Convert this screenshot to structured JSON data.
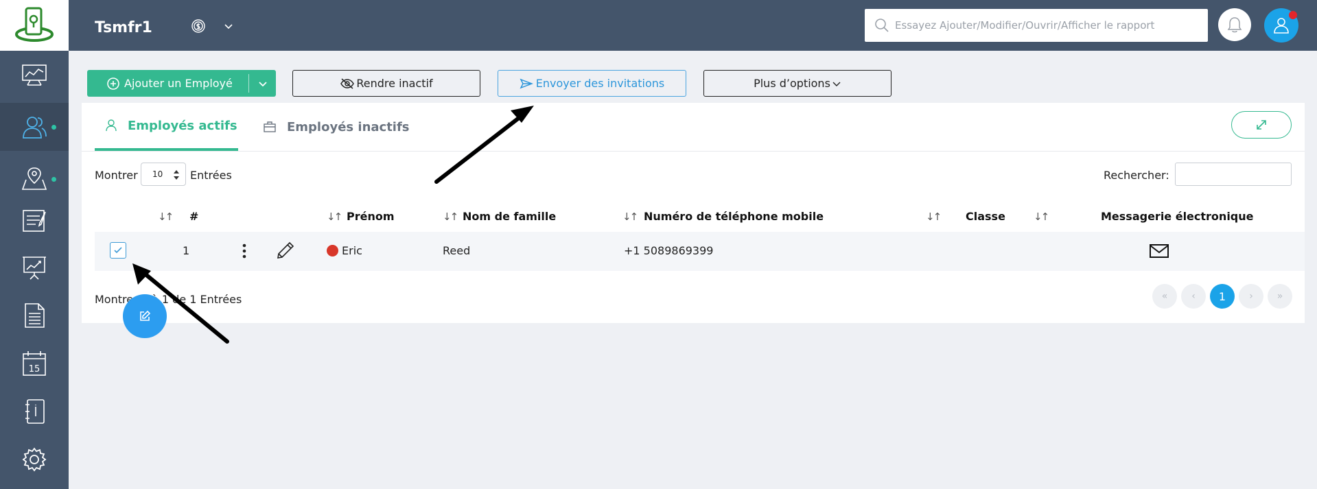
{
  "header": {
    "app_title": "Tsmfr1",
    "search_placeholder": "Essayez Ajouter/Modifier/Ouvrir/Afficher le rapport"
  },
  "sidebar": {
    "items": [
      {
        "icon": "dashboard-icon"
      },
      {
        "icon": "employees-icon",
        "active": true,
        "dot": true
      },
      {
        "icon": "map-location-icon",
        "dot": true
      },
      {
        "icon": "clipboard-icon"
      },
      {
        "icon": "presentation-chart-icon"
      },
      {
        "icon": "document-icon"
      },
      {
        "icon": "calendar-icon",
        "day": "15"
      },
      {
        "icon": "contacts-book-icon"
      },
      {
        "icon": "settings-gear-icon"
      }
    ]
  },
  "toolbar": {
    "add_label": "Ajouter un Employé",
    "deactivate_label": "Rendre inactif",
    "invite_label": "Envoyer des invitations",
    "more_label": "Plus d’options"
  },
  "tabs": {
    "active_label": "Employés actifs",
    "inactive_label": "Employés inactifs"
  },
  "table_controls": {
    "show_label": "Montrer",
    "page_size": "10",
    "entries_label": "Entrées",
    "search_label": "Rechercher:"
  },
  "table": {
    "headers": {
      "number": "#",
      "first_name": "Prénom",
      "last_name": "Nom de famille",
      "mobile": "Numéro de téléphone mobile",
      "class": "Classe",
      "email": "Messagerie électronique"
    },
    "rows": [
      {
        "checked": true,
        "number": "1",
        "first_name": "Eric",
        "last_name": "Reed",
        "mobile": "+1 5089869399",
        "class": "",
        "status_color": "#d8372a"
      }
    ]
  },
  "footer": {
    "info_text": "Montrer 1 à 1 de 1 Entrées",
    "current_page": "1"
  },
  "colors": {
    "sidebar": "#44556b",
    "accent_green": "#34b990",
    "accent_blue": "#1ba3e8"
  }
}
